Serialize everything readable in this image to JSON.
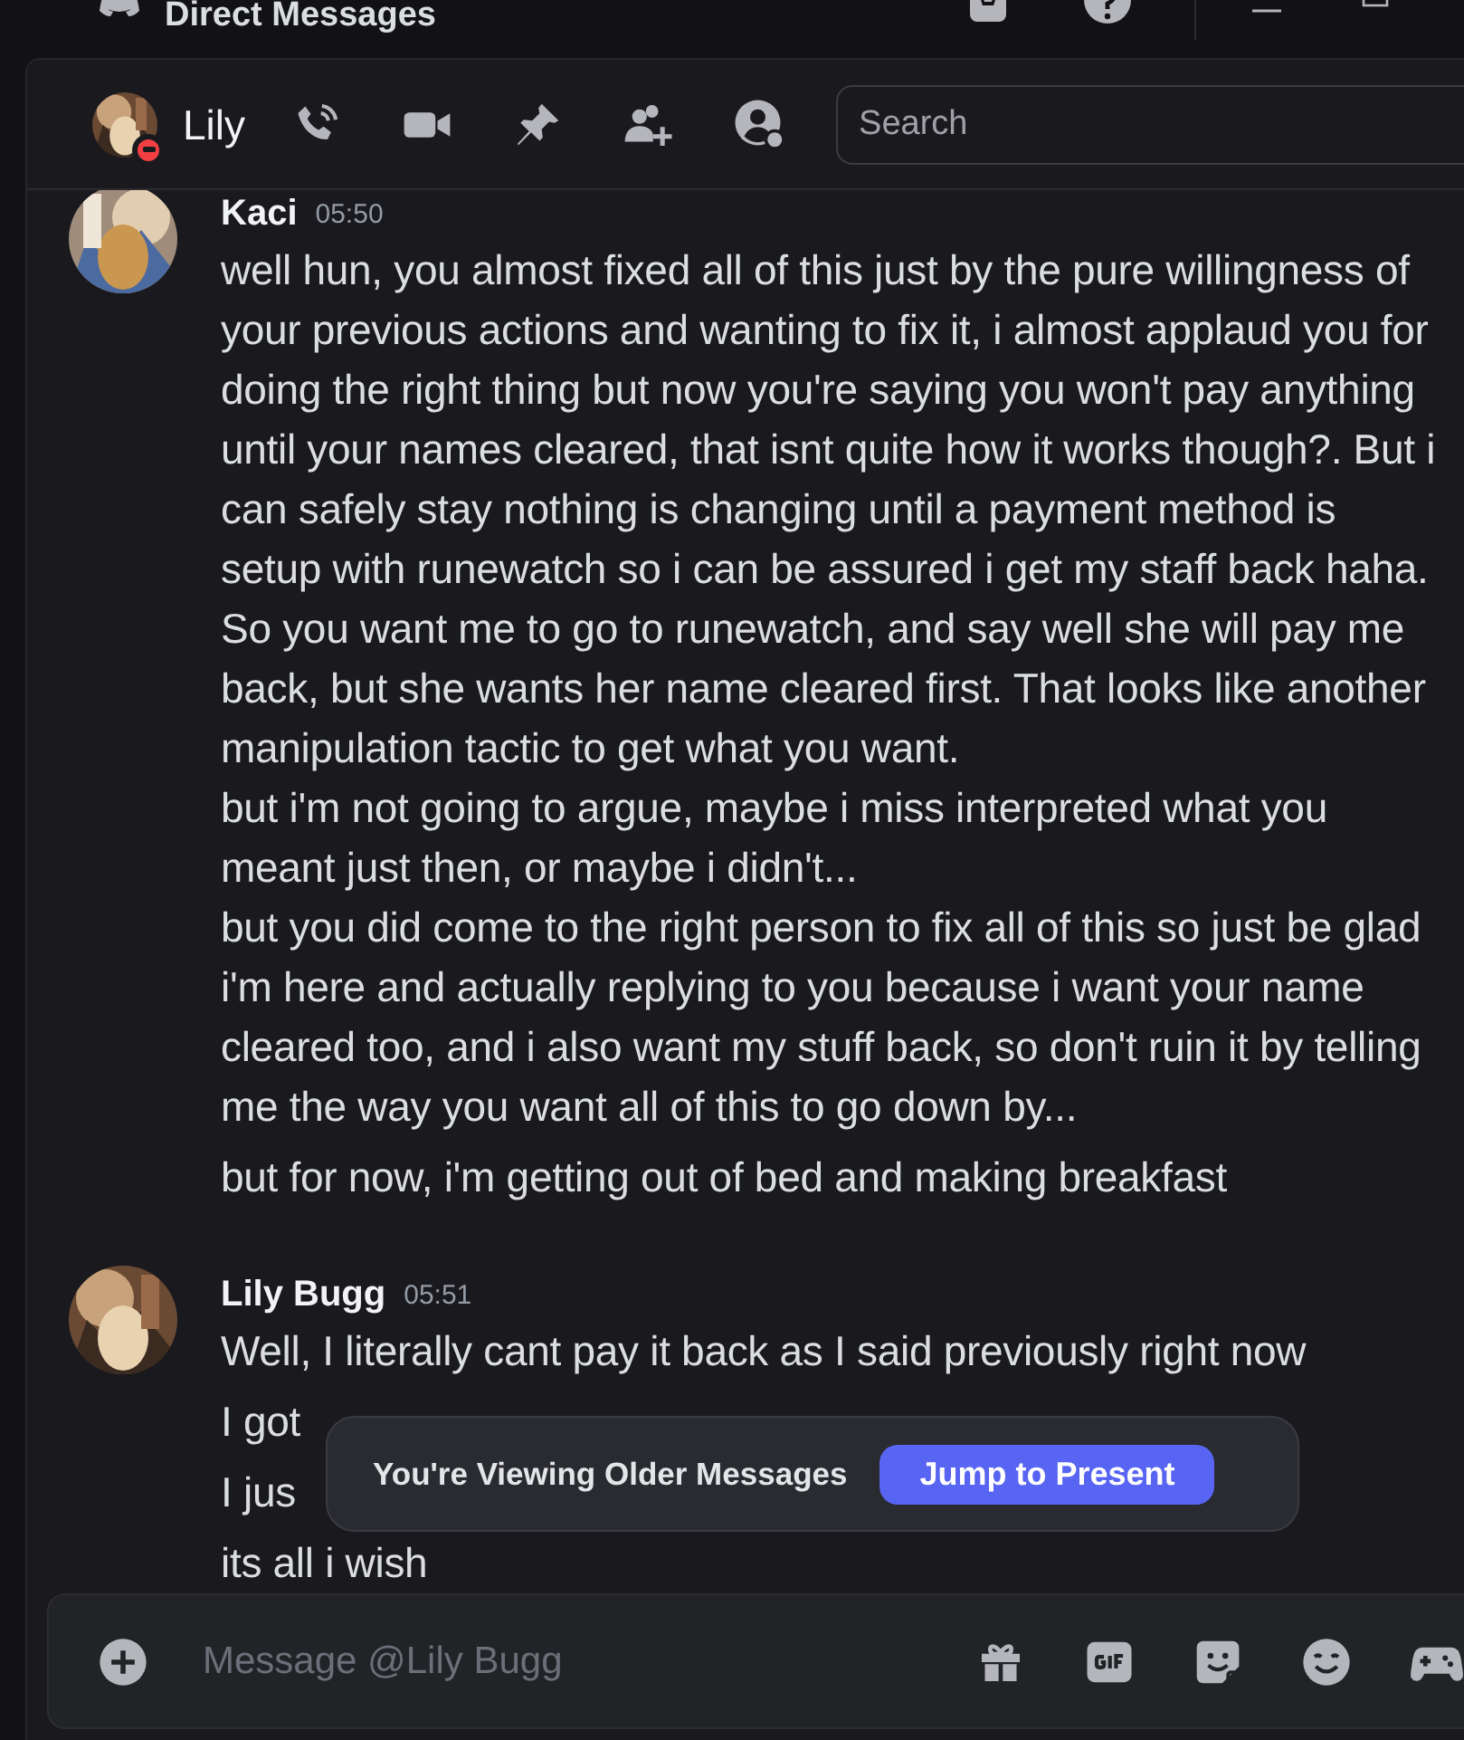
{
  "titlebar": {
    "title": "Direct Messages"
  },
  "header": {
    "name": "Lily",
    "do_not_disturb": true,
    "search": {
      "placeholder": "Search"
    }
  },
  "messages": [
    {
      "kind": "group",
      "author": "Kaci",
      "time": "05:50",
      "paragraphs": [
        "well hun, you almost fixed all of this just by the pure willingness of your previous actions and wanting to fix it, i almost applaud you for doing the right thing but now you're saying you won't pay anything until your names cleared, that isnt quite how it works though?. But i can safely stay nothing is changing until a payment method is setup with runewatch so i can be assured i get my staff back haha. So you want me to go to runewatch, and say well she will pay me back, but she wants her name cleared first. That looks like another manipulation tactic to get what you want.",
        "but i'm not going to argue, maybe i miss interpreted what you meant just then, or maybe i didn't...",
        "but you did come to the right person to fix all of this so just be glad i'm here and actually replying to you because i want your name cleared too, and i also want my stuff back, so don't ruin it by telling me the way you want all of this to go down by..."
      ]
    },
    {
      "kind": "continuation",
      "paragraphs": [
        "but for now, i'm getting out of bed and making breakfast"
      ]
    },
    {
      "kind": "group",
      "author": "Lily Bugg",
      "time": "05:51",
      "paragraphs": [
        "Well, I literally cant pay it back as I said previously right now"
      ]
    },
    {
      "kind": "continuation",
      "paragraphs": [
        "I got"
      ]
    },
    {
      "kind": "continuation",
      "paragraphs": [
        "I jus"
      ]
    },
    {
      "kind": "continuation",
      "paragraphs": [
        "its all i wish"
      ]
    }
  ],
  "banner": {
    "text": "You're Viewing Older Messages",
    "button": "Jump to Present"
  },
  "composer": {
    "placeholder": "Message @Lily Bugg"
  }
}
